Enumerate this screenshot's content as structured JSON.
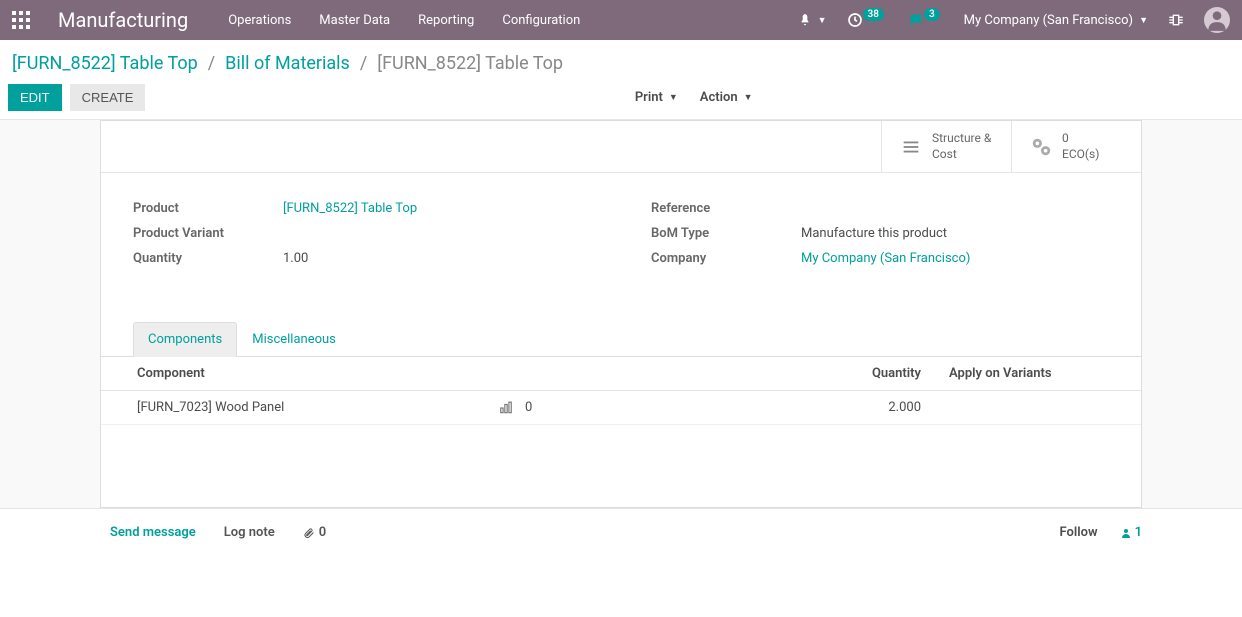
{
  "navbar": {
    "app_title": "Manufacturing",
    "menu": [
      "Operations",
      "Master Data",
      "Reporting",
      "Configuration"
    ],
    "activity_badge": "38",
    "chat_badge": "3",
    "company": "My Company (San Francisco)"
  },
  "breadcrumb": {
    "items": [
      "[FURN_8522] Table Top",
      "Bill of Materials"
    ],
    "current": "[FURN_8522] Table Top"
  },
  "controls": {
    "edit": "EDIT",
    "create": "CREATE",
    "print": "Print",
    "action": "Action"
  },
  "stat_buttons": {
    "structure": {
      "line1": "Structure &",
      "line2": "Cost"
    },
    "eco": {
      "count": "0",
      "label": "ECO(s)"
    }
  },
  "form": {
    "left": {
      "product_label": "Product",
      "product_value": "[FURN_8522] Table Top",
      "variant_label": "Product Variant",
      "variant_value": "",
      "qty_label": "Quantity",
      "qty_value": "1.00"
    },
    "right": {
      "ref_label": "Reference",
      "ref_value": "",
      "bom_type_label": "BoM Type",
      "bom_type_value": "Manufacture this product",
      "company_label": "Company",
      "company_value": "My Company (San Francisco)"
    }
  },
  "tabs": {
    "components": "Components",
    "misc": "Miscellaneous"
  },
  "components_table": {
    "headers": {
      "component": "Component",
      "quantity": "Quantity",
      "variants": "Apply on Variants"
    },
    "rows": [
      {
        "component": "[FURN_7023] Wood Panel",
        "forecast": "0",
        "qty": "2.000",
        "variants": ""
      }
    ]
  },
  "chatter": {
    "send": "Send message",
    "lognote": "Log note",
    "attach_count": "0",
    "follow": "Follow",
    "follower_count": "1"
  }
}
